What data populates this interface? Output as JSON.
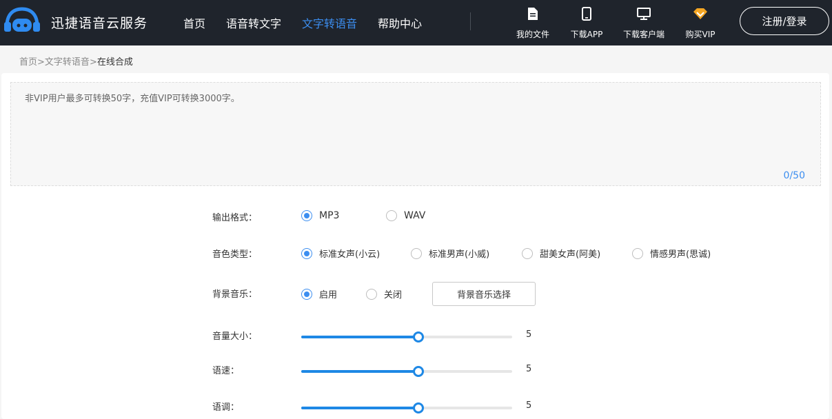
{
  "header": {
    "brand": "迅捷语音云服务",
    "nav": [
      "首页",
      "语音转文字",
      "文字转语音",
      "帮助中心"
    ],
    "active_nav": 2,
    "tools": [
      {
        "label": "我的文件",
        "icon": "file-icon"
      },
      {
        "label": "下载APP",
        "icon": "phone-icon"
      },
      {
        "label": "下载客户端",
        "icon": "monitor-icon"
      },
      {
        "label": "购买VIP",
        "icon": "vip-diamond-icon"
      }
    ],
    "login": "注册/登录"
  },
  "breadcrumb": {
    "home": "首页",
    "sep": ">",
    "section": "文字转语音",
    "current": "在线合成"
  },
  "editor": {
    "placeholder": "非VIP用户最多可转换50字，充值VIP可转换3000字。",
    "counter": "0/50"
  },
  "format": {
    "label": "输出格式：",
    "options": [
      "MP3",
      "WAV"
    ],
    "selected": 0
  },
  "voice": {
    "label": "音色类型：",
    "options": [
      "标准女声(小云)",
      "标准男声(小威)",
      "甜美女声(阿美)",
      "情感男声(思诚)"
    ],
    "selected": 0
  },
  "music": {
    "label": "背景音乐：",
    "options": [
      "启用",
      "关闭"
    ],
    "selected": 0,
    "choose_button": "背景音乐选择"
  },
  "volume": {
    "label": "音量大小：",
    "value": "5",
    "fraction": 0.555
  },
  "speed": {
    "label": "语速：",
    "value": "5",
    "fraction": 0.555
  },
  "pitch": {
    "label": "语调：",
    "value": "5",
    "fraction": 0.555
  },
  "colors": {
    "accent": "#3c8ef0",
    "slider": "#1e88e5",
    "header_bg": "#1f242c"
  }
}
